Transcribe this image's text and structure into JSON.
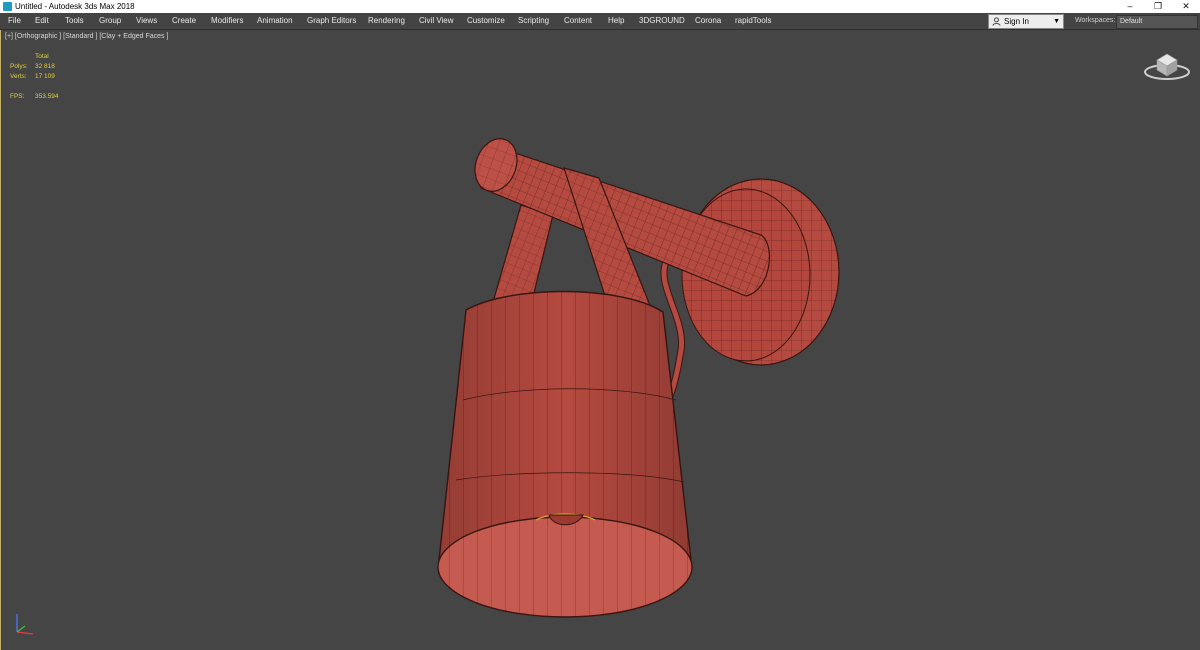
{
  "window": {
    "title": "Untitled - Autodesk 3ds Max 2018",
    "minimize_glyph": "–",
    "maximize_glyph": "❐",
    "close_glyph": "✕"
  },
  "menu": {
    "items": [
      "File",
      "Edit",
      "Tools",
      "Group",
      "Views",
      "Create",
      "Modifiers",
      "Animation",
      "Graph Editors",
      "Rendering",
      "Civil View",
      "Customize",
      "Scripting",
      "Content",
      "Help",
      "3DGROUND",
      "Corona",
      "rapidTools"
    ]
  },
  "account": {
    "signin_label": "Sign In",
    "dropdown_glyph": "▼"
  },
  "workspace": {
    "label": "Workspaces:",
    "value": "Default"
  },
  "viewport": {
    "label": "[+] [Orthographic ] [Standard ] [Clay + Edged Faces ]",
    "stats": {
      "header": "Total",
      "polys_label": "Polys:",
      "polys_value": "32 818",
      "verts_label": "Verts:",
      "verts_value": "17 109",
      "fps_label": "FPS:",
      "fps_value": "353.594"
    }
  },
  "colors": {
    "model_fill": "#b54a40",
    "wire": "#3a1512",
    "viewport_bg": "#454545",
    "stats_text": "#e2cf3a"
  },
  "icons": [
    "app-icon",
    "user-icon",
    "viewcube-icon",
    "axis-tripod-icon"
  ]
}
